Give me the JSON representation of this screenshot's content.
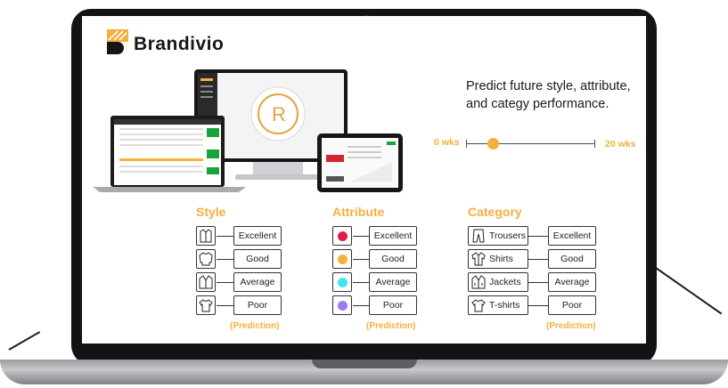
{
  "brand": {
    "name": "Brandivio"
  },
  "headline": "Predict future style, attribute, and categy performance.",
  "timeline": {
    "start_label": "0 wks",
    "end_label": "20 wks",
    "value_weeks": 4
  },
  "groups": {
    "style": {
      "title": "Style",
      "ratings": [
        "Excellent",
        "Good",
        "Average",
        "Poor"
      ],
      "icons": [
        "shirt-icon",
        "sweater-icon",
        "jacket-icon",
        "tshirt-icon"
      ],
      "prediction": "(Prediction)"
    },
    "attribute": {
      "title": "Attribute",
      "ratings": [
        "Excellent",
        "Good",
        "Average",
        "Poor"
      ],
      "colors": [
        "#e5184a",
        "#f3b03d",
        "#46e3f0",
        "#9b7df2"
      ],
      "prediction": "(Prediction)"
    },
    "category": {
      "title": "Category",
      "items": [
        "Trousers",
        "Shirts",
        "Jackets",
        "T-shirts"
      ],
      "ratings": [
        "Excellent",
        "Good",
        "Average",
        "Poor"
      ],
      "icons": [
        "trousers-icon",
        "shirt-icon",
        "jacket-icon",
        "tshirt-icon"
      ],
      "prediction": "(Prediction)"
    }
  },
  "colors": {
    "accent": "#f3b03d",
    "green": "#18a43c",
    "text": "#1a1a1a"
  }
}
